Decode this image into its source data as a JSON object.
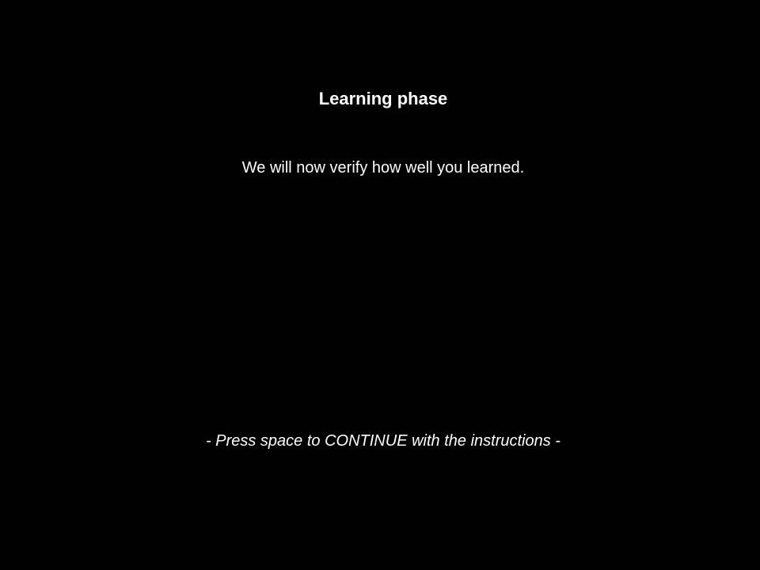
{
  "screen": {
    "title": "Learning phase",
    "message": "We will now verify how well you learned.",
    "prompt": "- Press space to CONTINUE with the instructions -",
    "background_color": "#000000",
    "text_color": "#ffffff"
  }
}
